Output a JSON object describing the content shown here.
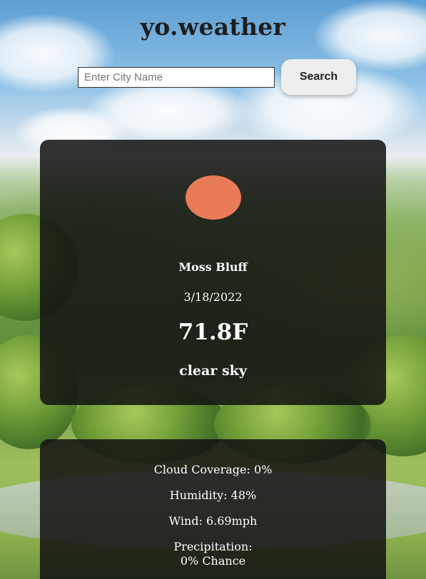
{
  "app": {
    "title": "yo.weather"
  },
  "search": {
    "placeholder": "Enter City Name",
    "value": "",
    "button_label": "Search"
  },
  "current": {
    "icon": "sun-icon",
    "icon_color": "#e97b59",
    "city": "Moss Bluff",
    "date": "3/18/2022",
    "temperature": "71.8F",
    "description": "clear sky"
  },
  "details": {
    "cloud_coverage": "Cloud Coverage: 0%",
    "humidity": "Humidity: 48%",
    "wind": "Wind: 6.69mph",
    "precipitation_label": "Precipitation:",
    "precipitation_value": "0% Chance"
  }
}
